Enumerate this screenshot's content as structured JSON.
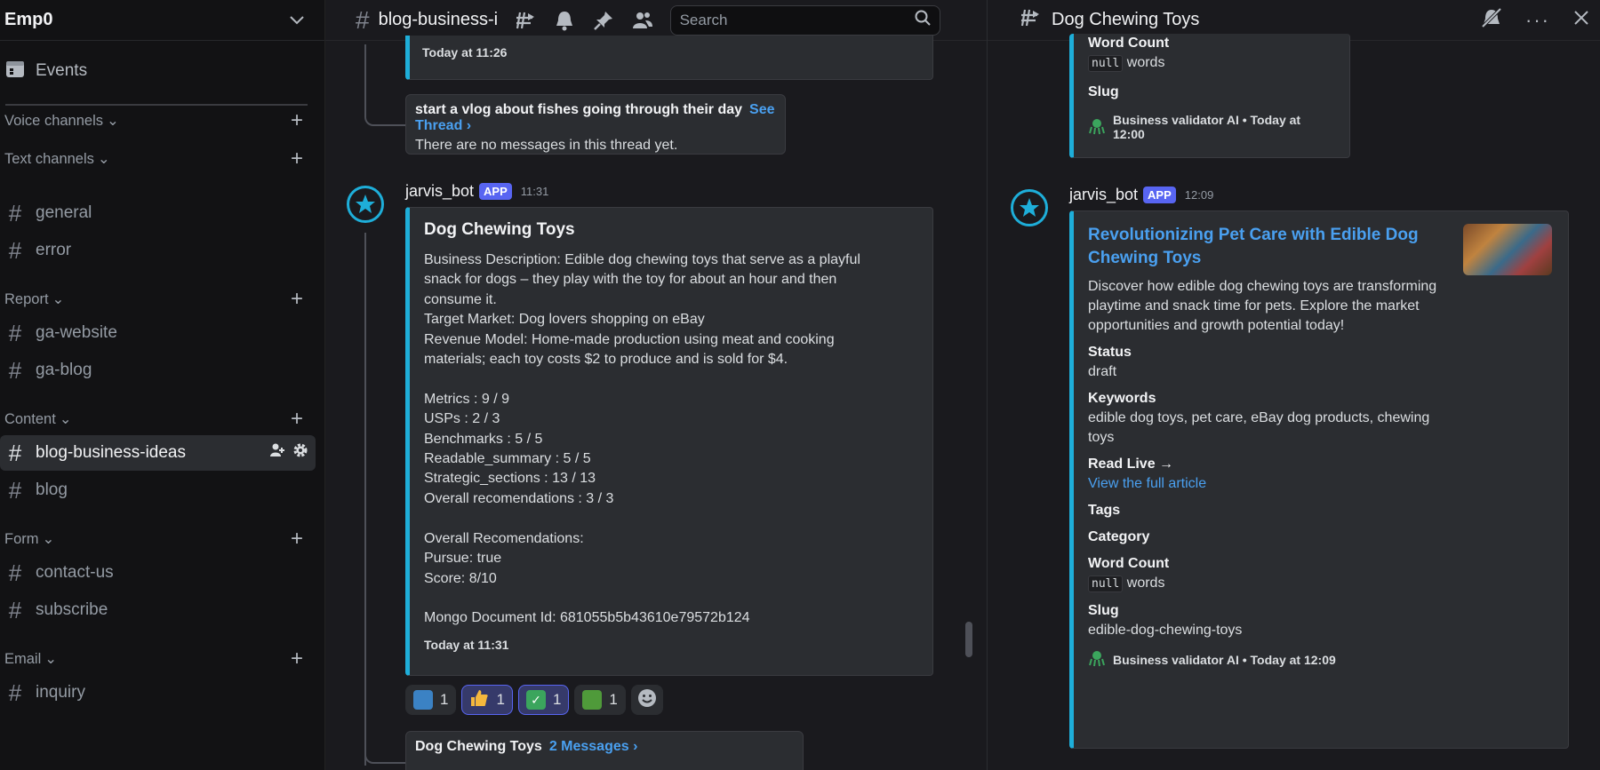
{
  "server": {
    "name": "Emp0"
  },
  "sidebar": {
    "events_label": "Events",
    "categories": [
      {
        "label": "Voice channels",
        "channels": []
      },
      {
        "label": "Text channels",
        "channels": [
          "general",
          "error"
        ]
      },
      {
        "label": "Report",
        "channels": [
          "ga-website",
          "ga-blog"
        ]
      },
      {
        "label": "Content",
        "channels": [
          "blog-business-ideas",
          "blog"
        ]
      },
      {
        "label": "Form",
        "channels": [
          "contact-us",
          "subscribe"
        ]
      },
      {
        "label": "Email",
        "channels": [
          "inquiry"
        ]
      }
    ],
    "active_channel": "blog-business-ideas"
  },
  "topbar": {
    "channel_name": "blog-business-ideas",
    "search_placeholder": "Search"
  },
  "main": {
    "prev_embed_time": "Today at 11:26",
    "thread1": {
      "title": "start a vlog about fishes going through their day",
      "link": "See Thread ›",
      "sub": "There are no messages in this thread yet."
    },
    "message": {
      "username": "jarvis_bot",
      "badge": "APP",
      "time": "11:31",
      "embed_title": "Dog Chewing Toys",
      "embed_body": "Business Description: Edible dog chewing toys that serve as a playful\nsnack for dogs – they play with the toy for about an hour and then\nconsume it.\nTarget Market: Dog lovers shopping on eBay\nRevenue Model: Home-made production using meat and cooking\nmaterials; each toy costs $2 to produce and is sold for $4.\n\nMetrics : 9 / 9\nUSPs : 2 / 3\nBenchmarks : 5 / 5\nReadable_summary : 5 / 5\nStrategic_sections : 13 / 13\nOverall recomendations : 3 / 3\n\nOverall Recomendations:\nPursue: true\nScore: 8/10\n\nMongo Document Id: 681055b5b43610e79572b124",
      "embed_time": "Today at 11:31"
    },
    "reactions": [
      {
        "emoji": "book-blue",
        "count": "1",
        "active": false
      },
      {
        "emoji": "thumbs-up",
        "count": "1",
        "active": true
      },
      {
        "emoji": "check",
        "count": "1",
        "active": true
      },
      {
        "emoji": "book-green",
        "count": "1",
        "active": false
      }
    ],
    "thread2": {
      "title": "Dog Chewing Toys",
      "link": "2 Messages ›"
    }
  },
  "right_panel": {
    "title": "Dog Chewing Toys",
    "top_embed": {
      "word_count_label": "Word Count",
      "word_count_code": "null",
      "word_count_suffix": "words",
      "slug_label": "Slug",
      "footer": "Business validator AI • Today at 12:00"
    },
    "message": {
      "username": "jarvis_bot",
      "badge": "APP",
      "time": "12:09",
      "title": "Revolutionizing Pet Care with Edible Dog Chewing Toys",
      "description": "Discover how edible dog chewing toys are transforming playtime and snack time for pets. Explore the market opportunities and growth potential today!",
      "status_label": "Status",
      "status_value": "draft",
      "keywords_label": "Keywords",
      "keywords_value": "edible dog toys, pet care, eBay dog products, chewing toys",
      "read_live_label": "Read Live →",
      "read_live_link": "View the full article",
      "tags_label": "Tags",
      "category_label": "Category",
      "word_count_label": "Word Count",
      "word_count_code": "null",
      "word_count_suffix": "words",
      "slug_label": "Slug",
      "slug_value": "edible-dog-chewing-toys",
      "footer": "Business validator AI • Today at 12:09"
    }
  },
  "colors": {
    "accent": "#1eaed9",
    "link": "#4aa0f0",
    "badge": "#5865f2"
  }
}
